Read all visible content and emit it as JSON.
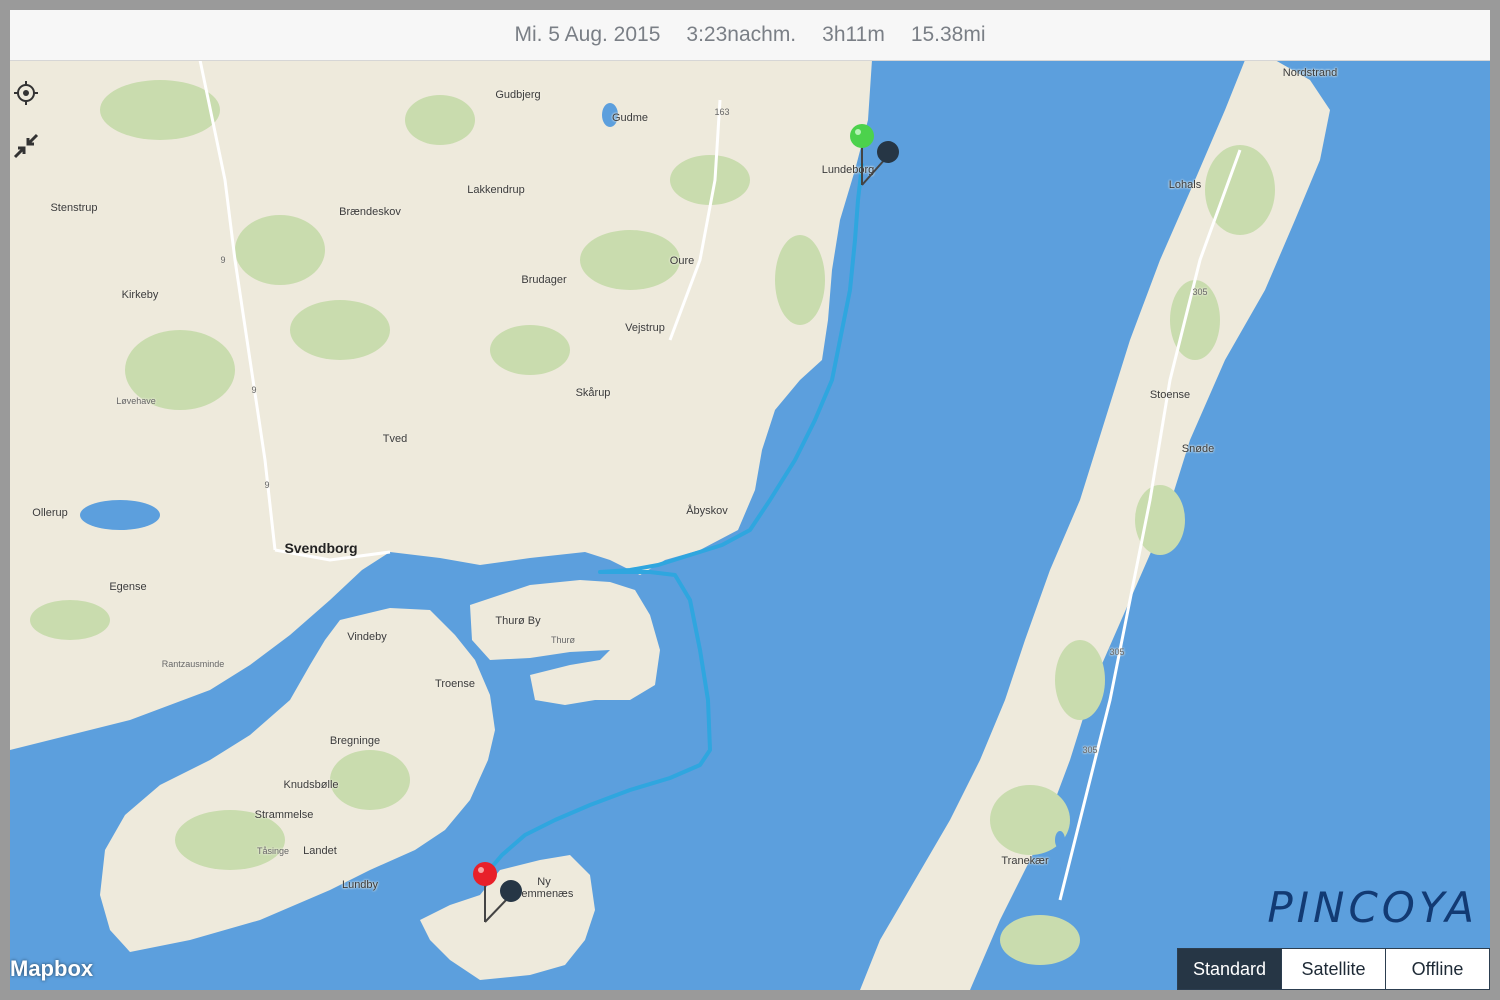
{
  "topbar": {
    "date": "Mi. 5 Aug. 2015",
    "time": "3:23nachm.",
    "duration": "3h11m",
    "distance": "15.38mi"
  },
  "controls": {
    "locate_icon": "crosshair-icon",
    "collapse_icon": "collapse-arrows-icon"
  },
  "places": {
    "gudbjerg": "Gudbjerg",
    "gudme": "Gudme",
    "lundeborg": "Lundeborg",
    "lakkendrup": "Lakkendrup",
    "stenstrup": "Stenstrup",
    "braendeskov": "Brændeskov",
    "oure": "Oure",
    "brudager": "Brudager",
    "kirkeby": "Kirkeby",
    "vejstrup": "Vejstrup",
    "lovehave": "Løvehave",
    "skarup": "Skårup",
    "tved": "Tved",
    "abyskov": "Åbyskov",
    "ollerup": "Ollerup",
    "svendborg": "Svendborg",
    "egense": "Egense",
    "thuro_by": "Thurø By",
    "thuro": "Thurø",
    "vindeby": "Vindeby",
    "rantzausminde": "Rantzausminde",
    "troense": "Troense",
    "bregninge": "Bregninge",
    "knudsbolle": "Knudsbølle",
    "strammelse": "Strammelse",
    "tasinge": "Tåsinge",
    "landet": "Landet",
    "lundby": "Lundby",
    "ny_vemmenaes": "Ny\nVemmenæs",
    "nordstrand": "Nordstrand",
    "lohals": "Lohals",
    "stoense": "Stoense",
    "snode": "Snøde",
    "tranekaer": "Tranekær",
    "road_163": "163",
    "road_305a": "305",
    "road_305b": "305",
    "road_305c": "305",
    "road_9a": "9",
    "road_9b": "9",
    "road_9c": "9"
  },
  "markers": {
    "start_color": "#4cd24c",
    "end_color": "#e8202a",
    "track_color": "#2fa6df"
  },
  "map_types": {
    "standard": "Standard",
    "satellite": "Satellite",
    "offline": "Offline",
    "selected": "Standard"
  },
  "attribution": "Mapbox",
  "watermark": "PINCOYA",
  "colors": {
    "water": "#5c9fdd",
    "land": "#eeeadc",
    "forest": "#c9dcae"
  }
}
